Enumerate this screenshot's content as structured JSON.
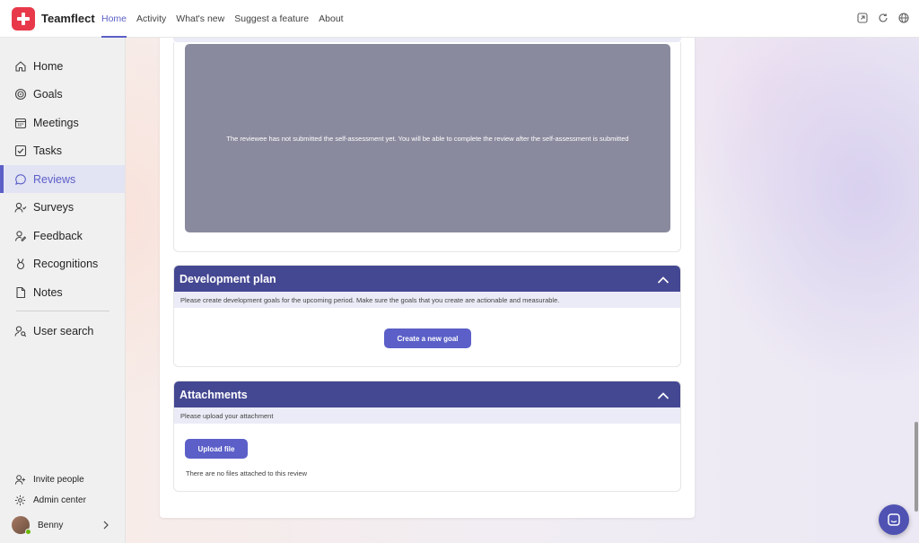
{
  "app": {
    "name": "Teamflect",
    "brand_color": "#e8394a",
    "accent_color": "#5b5fc7",
    "section_header_color": "#444791"
  },
  "topbar": {
    "tabs": [
      {
        "label": "Home",
        "active": true
      },
      {
        "label": "Activity",
        "active": false
      },
      {
        "label": "What's new",
        "active": false
      },
      {
        "label": "Suggest a feature",
        "active": false
      },
      {
        "label": "About",
        "active": false
      }
    ],
    "icons": [
      "popout-icon",
      "refresh-icon",
      "globe-icon"
    ]
  },
  "sidebar": {
    "items": [
      {
        "label": "Home",
        "icon": "home-icon",
        "active": false
      },
      {
        "label": "Goals",
        "icon": "goals-icon",
        "active": false
      },
      {
        "label": "Meetings",
        "icon": "calendar-icon",
        "active": false
      },
      {
        "label": "Tasks",
        "icon": "checkbox-icon",
        "active": false
      },
      {
        "label": "Reviews",
        "icon": "speech-bubble-icon",
        "active": true
      },
      {
        "label": "Surveys",
        "icon": "survey-icon",
        "active": false
      },
      {
        "label": "Feedback",
        "icon": "person-feedback-icon",
        "active": false
      },
      {
        "label": "Recognitions",
        "icon": "medal-icon",
        "active": false
      },
      {
        "label": "Notes",
        "icon": "note-icon",
        "active": false
      }
    ],
    "user_search": {
      "label": "User search",
      "icon": "person-search-icon"
    },
    "invite": {
      "label": "Invite people",
      "icon": "person-add-icon"
    },
    "admin": {
      "label": "Admin center",
      "icon": "gear-icon"
    },
    "user": {
      "name": "Benny",
      "presence": "available"
    }
  },
  "review": {
    "assessment_notice": "The reviewee has not submitted the self-assessment yet. You will be able to complete the review after the self-assessment is submitted",
    "development_plan": {
      "title": "Development plan",
      "description": "Please create development goals for the upcoming period. Make sure the goals that you create are actionable and measurable.",
      "button": "Create a new goal"
    },
    "attachments": {
      "title": "Attachments",
      "description": "Please upload your attachment",
      "button": "Upload file",
      "empty_text": "There are no files attached to this review"
    }
  }
}
